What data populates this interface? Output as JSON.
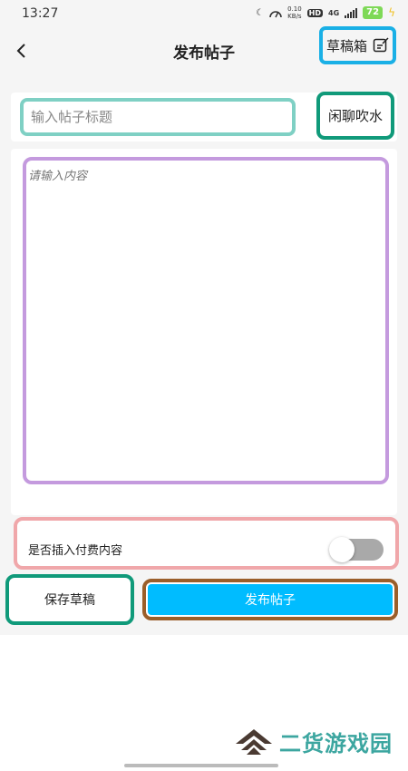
{
  "status_bar": {
    "time": "13:27",
    "net_speed_value": "0.10",
    "net_speed_unit": "KB/s",
    "hd_badge": "HD",
    "network": "4G",
    "battery": "72"
  },
  "header": {
    "title": "发布帖子",
    "drafts_label": "草稿箱"
  },
  "form": {
    "title_placeholder": "输入帖子标题",
    "category": "闲聊吹水",
    "content_placeholder": "请输入内容",
    "paid_label": "是否插入付费内容",
    "paid_enabled": false
  },
  "actions": {
    "save_draft": "保存草稿",
    "publish": "发布帖子"
  },
  "watermark": {
    "text": "二货游戏园"
  },
  "colors": {
    "accent": "#00bcff",
    "toggle_off": "#a9a9a9"
  }
}
